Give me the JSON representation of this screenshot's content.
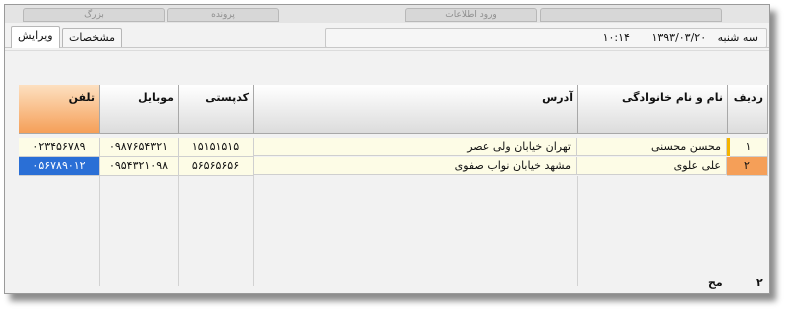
{
  "top_tabs": [
    "بزرگ",
    "پرونده",
    "ورود اطلاعات"
  ],
  "tabs": [
    {
      "label": "ویرایش",
      "active": true
    },
    {
      "label": "مشخصات",
      "active": false
    }
  ],
  "datetime": {
    "day": "سه شنبه",
    "date": "۱۳۹۳/۰۳/۲۰",
    "time": "۱۰:۱۴"
  },
  "grid": {
    "columns": [
      "ردیف",
      "نام و نام خانوادگی",
      "آدرس",
      "کدپستی",
      "موبایل",
      "تلفن"
    ],
    "rows": [
      [
        "۱",
        "محسن محسنی",
        "تهران خیابان ولی عصر",
        "۱۵۱۵۱۵۱۵",
        "۰۹۸۷۶۵۴۳۲۱",
        "۰۲۳۴۵۶۷۸۹"
      ],
      [
        "۲",
        "علی علوی",
        "مشهد خیابان نواب صفوی",
        "۵۶۵۶۵۶۵۶",
        "۰۹۵۴۳۲۱۰۹۸",
        "۰۵۶۷۸۹۰۱۲"
      ]
    ]
  },
  "footer": {
    "left": "مح",
    "right": "۲"
  }
}
